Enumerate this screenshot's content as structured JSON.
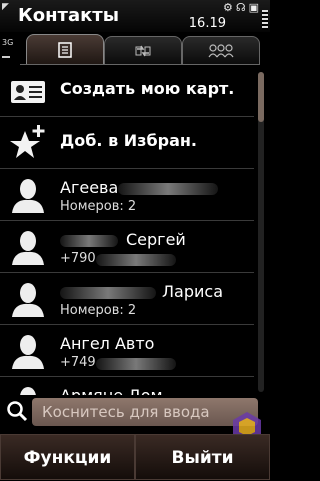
{
  "status": {
    "title": "Контакты",
    "time": "16.19",
    "network": "3G",
    "icons": [
      "settings-icon",
      "headset-icon",
      "lock-icon"
    ]
  },
  "tabs": [
    {
      "icon": "contact-card-icon",
      "active": true
    },
    {
      "icon": "sync-icon",
      "active": false
    },
    {
      "icon": "group-icon",
      "active": false
    }
  ],
  "actions": [
    {
      "label": "Создать мою карт.",
      "icon": "business-card-icon"
    },
    {
      "label": "Доб. в Избран.",
      "icon": "star-add-icon"
    }
  ],
  "contacts": [
    {
      "name": "Агеева",
      "sub": "Номеров: 2"
    },
    {
      "name": "Сергей",
      "sub": "+790"
    },
    {
      "name": "Лариса",
      "sub": "Номеров: 2"
    },
    {
      "name": "Ангел Авто",
      "sub": "+749"
    },
    {
      "name": "Армяне Дом",
      "sub": ""
    }
  ],
  "search": {
    "placeholder": "Коснитесь для ввода"
  },
  "softkeys": {
    "left": "Функции",
    "right": "Выйти"
  },
  "colors": {
    "accent": "#7a6a60",
    "search_bg": "#8e776c"
  }
}
